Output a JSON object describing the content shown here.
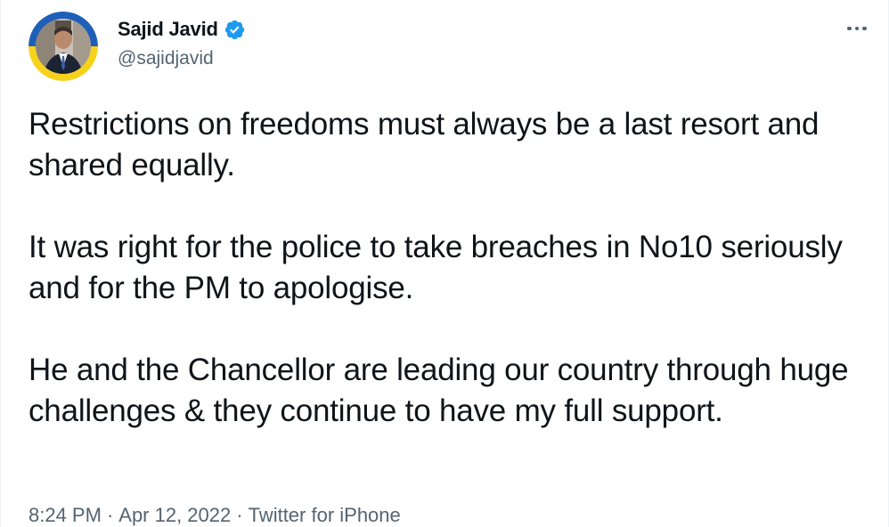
{
  "author": {
    "display_name": "Sajid Javid",
    "handle": "@sajidjavid",
    "verified": true,
    "avatar_icon": "profile-photo-with-ukraine-flag-ring"
  },
  "tweet": {
    "paragraphs": [
      "Restrictions on freedoms must always be a last resort and shared equally.",
      "It was right for the police to take breaches in No10 seriously and for the PM to apologise.",
      "He and the Chancellor are leading our country through huge challenges & they continue to have my full support."
    ]
  },
  "meta": {
    "time": "8:24 PM",
    "separator": "·",
    "date": "Apr 12, 2022",
    "source": "Twitter for iPhone"
  },
  "menu": {
    "icon": "more-dots-icon"
  },
  "colors": {
    "text": "#0f1419",
    "secondary": "#536471",
    "verified": "#1d9bf0",
    "ukraine_blue": "#1f5fb8",
    "ukraine_yellow": "#f7d21c"
  }
}
